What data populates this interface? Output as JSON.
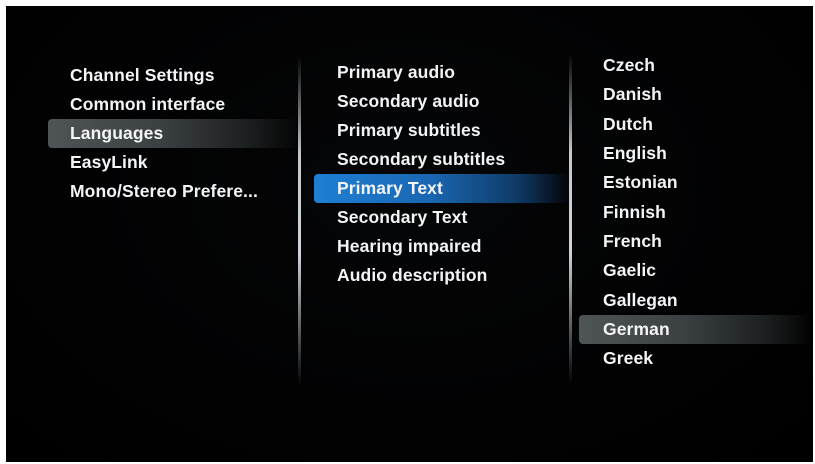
{
  "menu": {
    "column1": {
      "items": [
        "Channel Settings",
        "Common interface",
        "Languages",
        "EasyLink",
        "Mono/Stereo Prefere..."
      ],
      "selected_index": 2
    },
    "column2": {
      "items": [
        "Primary audio",
        "Secondary audio",
        "Primary subtitles",
        "Secondary subtitles",
        "Primary Text",
        "Secondary Text",
        "Hearing impaired",
        "Audio description"
      ],
      "selected_index": 4
    },
    "column3": {
      "items": [
        "Czech",
        "Danish",
        "Dutch",
        "English",
        "Estonian",
        "Finnish",
        "French",
        "Gaelic",
        "Gallegan",
        "German",
        "Greek"
      ],
      "selected_index": 9
    }
  },
  "colors": {
    "background": "#000000",
    "text": "#f3f4f6",
    "highlight_focus": "#1f7fd4",
    "highlight_path": "#4f5456"
  }
}
